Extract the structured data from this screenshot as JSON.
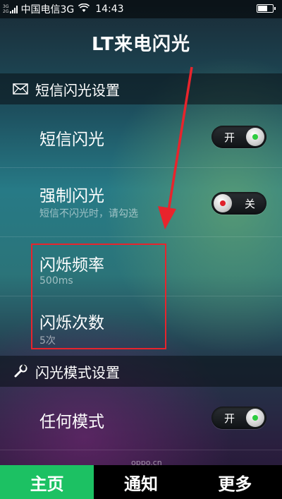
{
  "status_bar": {
    "network_top": "3G",
    "network_bottom": "2G",
    "carrier": "中国电信3G",
    "time": "14:43",
    "battery_level": 0.7
  },
  "title": "LT来电闪光",
  "sms_section": {
    "header": "短信闪光设置",
    "icon": "envelope-icon",
    "rows": [
      {
        "title": "短信闪光",
        "toggle_label": "开",
        "toggle_state": "on"
      },
      {
        "title": "强制闪光",
        "subtitle": "短信不闪光时，请勾选",
        "toggle_label": "关",
        "toggle_state": "off"
      },
      {
        "title": "闪烁频率",
        "subtitle": "500ms"
      },
      {
        "title": "闪烁次数",
        "subtitle": "5次"
      }
    ]
  },
  "mode_section": {
    "header": "闪光模式设置",
    "icon": "wrench-icon",
    "rows": [
      {
        "title": "任何模式",
        "toggle_label": "开",
        "toggle_state": "on"
      }
    ]
  },
  "watermark": "oppo.cn",
  "tabs": [
    {
      "label": "主页",
      "active": true
    },
    {
      "label": "通知",
      "active": false
    },
    {
      "label": "更多",
      "active": false
    }
  ],
  "colors": {
    "accent_green": "#1cc163",
    "toggle_on_dot": "#2ecc40",
    "toggle_off_dot": "#e0202a",
    "annotation_red": "#e8242c"
  }
}
